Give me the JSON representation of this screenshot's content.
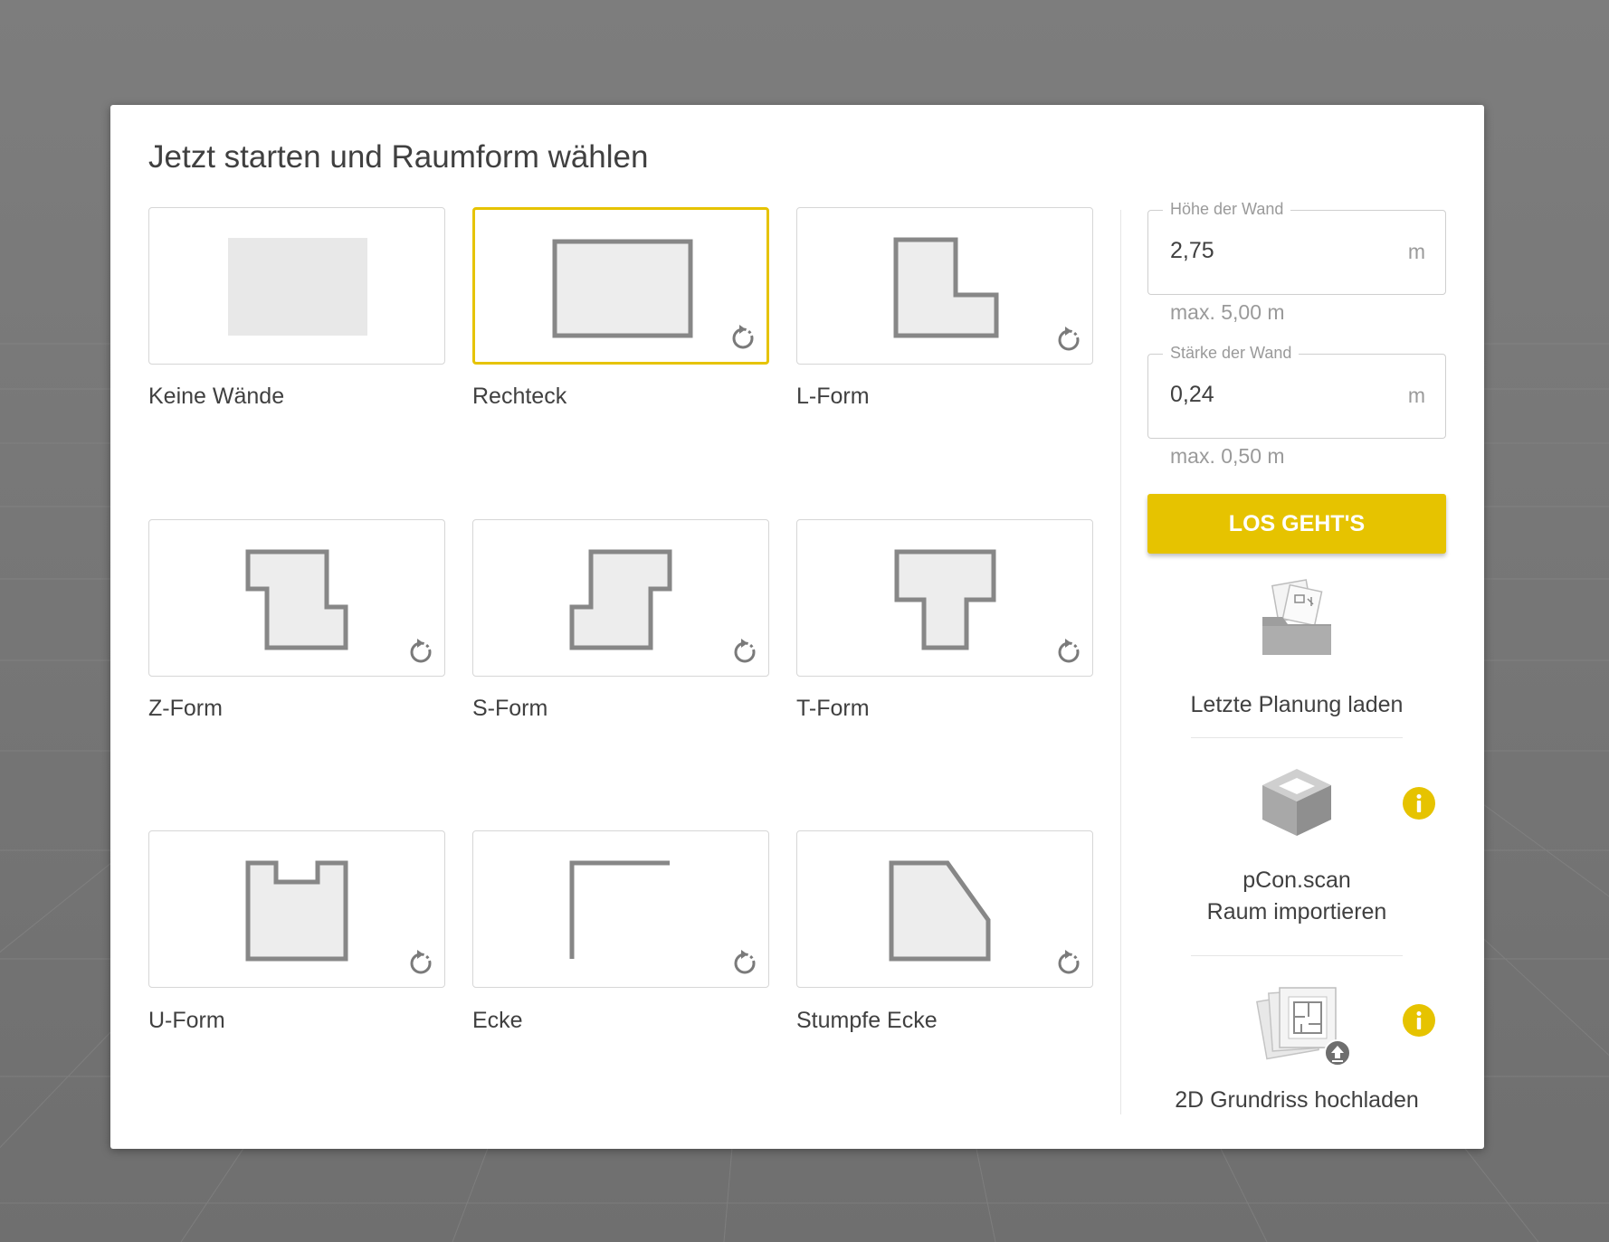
{
  "dialog": {
    "title": "Jetzt starten und Raumform wählen"
  },
  "accent_color": "#e6c300",
  "shapes": [
    {
      "label": "Keine Wände",
      "icon": "no-walls-shape-icon",
      "rotatable": false,
      "selected": false
    },
    {
      "label": "Rechteck",
      "icon": "rectangle-shape-icon",
      "rotatable": true,
      "selected": true
    },
    {
      "label": "L-Form",
      "icon": "l-shape-icon",
      "rotatable": true,
      "selected": false
    },
    {
      "label": "Z-Form",
      "icon": "z-shape-icon",
      "rotatable": true,
      "selected": false
    },
    {
      "label": "S-Form",
      "icon": "s-shape-icon",
      "rotatable": true,
      "selected": false
    },
    {
      "label": "T-Form",
      "icon": "t-shape-icon",
      "rotatable": true,
      "selected": false
    },
    {
      "label": "U-Form",
      "icon": "u-shape-icon",
      "rotatable": true,
      "selected": false
    },
    {
      "label": "Ecke",
      "icon": "corner-shape-icon",
      "rotatable": true,
      "selected": false
    },
    {
      "label": "Stumpfe Ecke",
      "icon": "obtuse-corner-shape-icon",
      "rotatable": true,
      "selected": false
    }
  ],
  "settings": {
    "wall_height": {
      "legend": "Höhe der Wand",
      "value": "2,75",
      "unit": "m",
      "hint": "max. 5,00 m"
    },
    "wall_thickness": {
      "legend": "Stärke der Wand",
      "value": "0,24",
      "unit": "m",
      "hint": "max. 0,50 m"
    },
    "start_button": "LOS GEHT'S"
  },
  "actions": {
    "load_last": {
      "label": "Letzte Planung laden",
      "icon": "folder-icon"
    },
    "pcon_scan": {
      "line1": "pCon.scan",
      "line2": "Raum importieren",
      "icon": "box-scan-icon",
      "info_icon": "info-icon"
    },
    "upload_2d": {
      "label": "2D Grundriss hochladen",
      "icon": "floorplan-upload-icon",
      "info_icon": "info-icon"
    }
  }
}
